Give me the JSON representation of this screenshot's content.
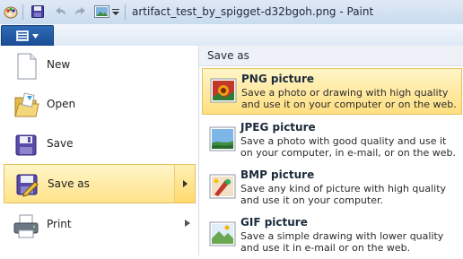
{
  "window": {
    "title": "artifact_test_by_spigget-d32bgoh.png - Paint"
  },
  "quick_access": {
    "icons": [
      "paint-app-icon",
      "save-icon",
      "undo-icon",
      "redo-icon",
      "image-icon",
      "customize-dropdown-icon"
    ]
  },
  "menu": {
    "left_items": [
      {
        "label": "New",
        "icon": "new-file-icon"
      },
      {
        "label": "Open",
        "icon": "open-folder-icon"
      },
      {
        "label": "Save",
        "icon": "save-disk-icon"
      },
      {
        "label": "Save as",
        "icon": "save-as-icon"
      },
      {
        "label": "Print",
        "icon": "printer-icon"
      }
    ],
    "right_header": "Save as",
    "save_as_options": [
      {
        "title": "PNG picture",
        "description": "Save a photo or drawing with high quality and use it on your computer or on the web.",
        "icon": "png-picture-icon"
      },
      {
        "title": "JPEG picture",
        "description": "Save a photo with good quality and use it on your computer, in e-mail, or on the web.",
        "icon": "jpeg-picture-icon"
      },
      {
        "title": "BMP picture",
        "description": "Save any kind of picture with high quality and use it on your computer.",
        "icon": "bmp-picture-icon"
      },
      {
        "title": "GIF picture",
        "description": "Save a simple drawing with lower quality and use it in e-mail or on the web.",
        "icon": "gif-picture-icon"
      }
    ]
  },
  "colors": {
    "highlight_top": "#fff5c8",
    "highlight_bottom": "#ffdf80",
    "app_button": "#1f59a6"
  }
}
